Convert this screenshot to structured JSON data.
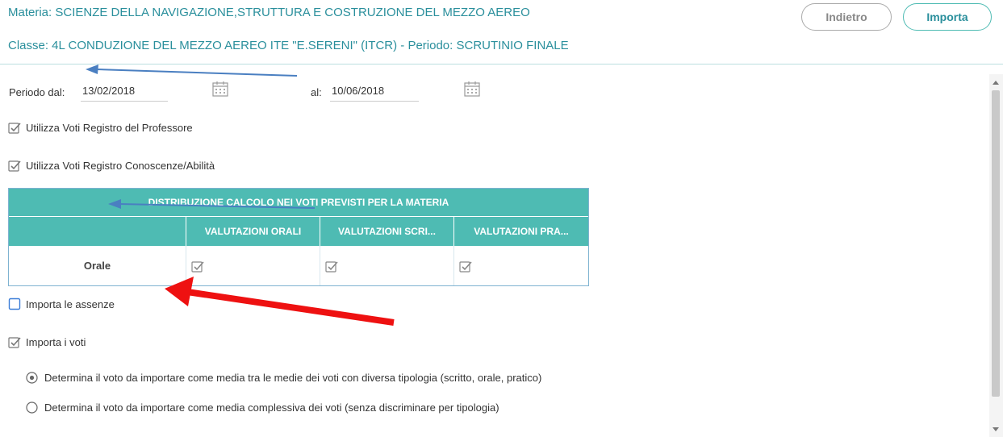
{
  "header": {
    "subject_line": "Materia: SCIENZE DELLA NAVIGAZIONE,STRUTTURA E COSTRUZIONE DEL MEZZO AEREO",
    "class_line": "Classe: 4L CONDUZIONE DEL MEZZO AEREO ITE \"E.SERENI\" (ITCR) - Periodo: SCRUTINIO FINALE",
    "back_label": "Indietro",
    "import_label": "Importa"
  },
  "period": {
    "from_label": "Periodo dal:",
    "from_value": "13/02/2018",
    "to_label": "al:",
    "to_value": "10/06/2018"
  },
  "options": {
    "use_teacher_register": "Utilizza Voti Registro del Professore",
    "use_knowledge_register": "Utilizza Voti Registro Conoscenze/Abilità",
    "import_absences": "Importa le assenze",
    "import_grades": "Importa i voti"
  },
  "table": {
    "title": "DISTRIBUZIONE CALCOLO NEI VOTI PREVISTI PER LA MATERIA",
    "columns": [
      "",
      "VALUTAZIONI ORALI",
      "VALUTAZIONI SCRI...",
      "VALUTAZIONI PRA..."
    ],
    "rows": [
      {
        "label": "Orale",
        "orali": true,
        "scritte": true,
        "pratiche": true
      }
    ]
  },
  "grade_mode": {
    "option_1": "Determina il voto da importare come media tra le medie dei voti con diversa tipologia (scritto, orale, pratico)",
    "option_2": "Determina il voto da importare come media complessiva dei voti (senza discriminare per tipologia)",
    "selected": 1
  },
  "colors": {
    "accent": "#4ebbb3",
    "header_text": "#2a8f9c",
    "annotation_red": "#ee1111",
    "annotation_blue": "#4a7fc1"
  }
}
